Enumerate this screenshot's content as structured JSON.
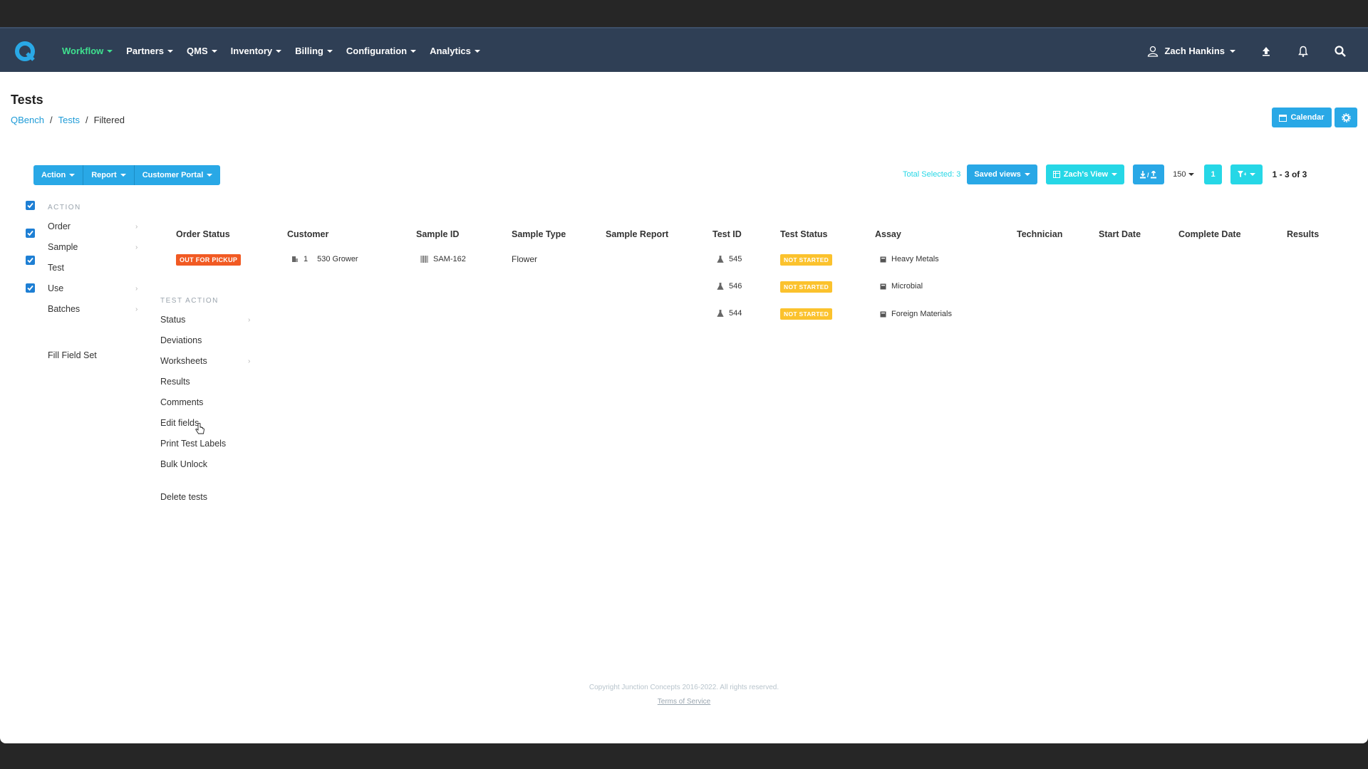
{
  "nav": {
    "items": [
      {
        "label": "Workflow"
      },
      {
        "label": "Partners"
      },
      {
        "label": "QMS"
      },
      {
        "label": "Inventory"
      },
      {
        "label": "Billing"
      },
      {
        "label": "Configuration"
      },
      {
        "label": "Analytics"
      }
    ],
    "user_name": "Zach Hankins",
    "icons": [
      "upload-icon",
      "bell-icon",
      "search-icon"
    ]
  },
  "page": {
    "title": "Tests",
    "breadcrumb": [
      "QBench",
      "Tests",
      "Filtered"
    ],
    "calendar_label": "Calendar"
  },
  "actionbar": {
    "action_label": "Action",
    "report_label": "Report",
    "portal_label": "Customer Portal"
  },
  "toolbar": {
    "total_selected": "Total Selected: 3",
    "saved_views": "Saved views",
    "view_name": "Zach's View",
    "per_page": "150",
    "page_number": "1",
    "page_count": "1 - 3 of 3"
  },
  "action_menu": {
    "heading": "ACTION",
    "items": [
      "Order",
      "Sample",
      "Test",
      "Use",
      "Batches"
    ],
    "extra": "Fill Field Set"
  },
  "test_action_menu": {
    "heading": "TEST ACTION",
    "items": [
      "Status",
      "Deviations",
      "Worksheets",
      "Results",
      "Comments",
      "Edit fields",
      "Print Test Labels",
      "Bulk Unlock"
    ],
    "delete": "Delete tests"
  },
  "table": {
    "headers": [
      "Order Status",
      "Customer",
      "Sample ID",
      "Sample Type",
      "Sample Report",
      "Test ID",
      "Test Status",
      "Assay",
      "Technician",
      "Start Date",
      "Complete Date",
      "Results"
    ],
    "order_status": "OUT FOR PICKUP",
    "customer_count": "1",
    "customer": "530 Grower",
    "sample_id": "SAM-162",
    "sample_type": "Flower",
    "rows": [
      {
        "test_id": "545",
        "status": "NOT STARTED",
        "assay": "Heavy Metals"
      },
      {
        "test_id": "546",
        "status": "NOT STARTED",
        "assay": "Microbial"
      },
      {
        "test_id": "544",
        "status": "NOT STARTED",
        "assay": "Foreign Materials"
      }
    ]
  },
  "footer": {
    "copyright": "Copyright Junction Concepts 2016-2022. All rights reserved.",
    "terms": "Terms of Service"
  },
  "colors": {
    "topbar": "#2f3f55",
    "accent": "#29a8e6",
    "active_nav": "#3fe08f",
    "badge_red": "#f15a23",
    "badge_yellow": "#fbc22d"
  }
}
